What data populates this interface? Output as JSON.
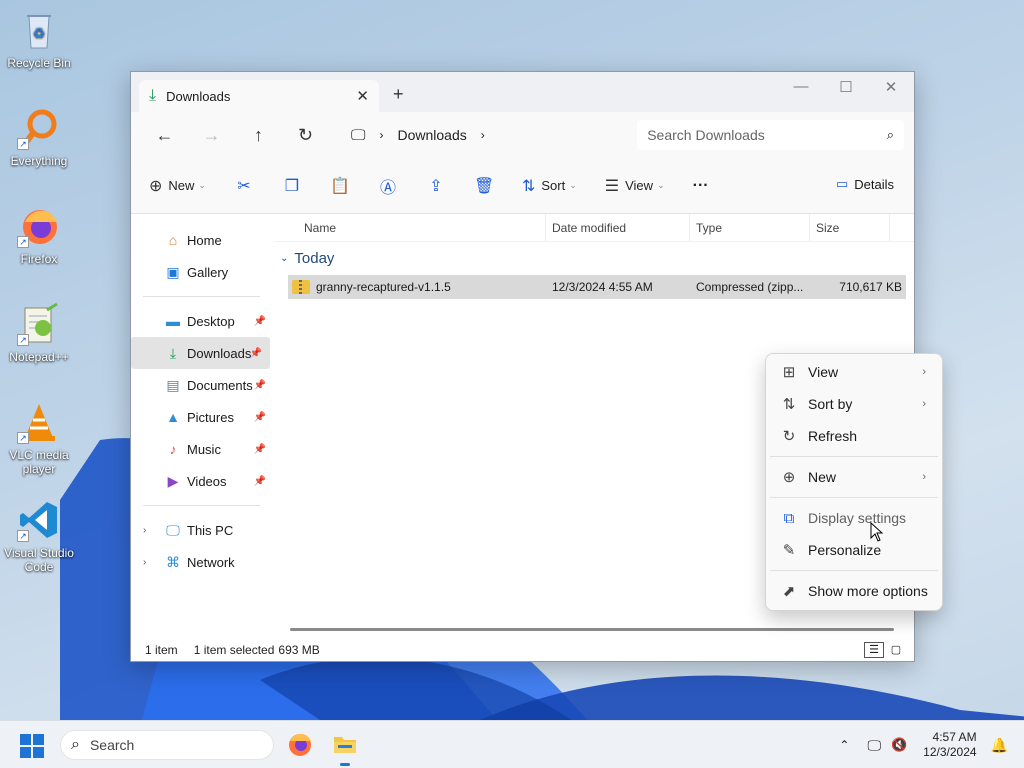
{
  "desktop": {
    "icons": [
      {
        "label": "Recycle Bin",
        "icon": "recycle-bin-icon"
      },
      {
        "label": "Everything",
        "icon": "everything-search-icon"
      },
      {
        "label": "Firefox",
        "icon": "firefox-icon"
      },
      {
        "label": "Notepad++",
        "icon": "notepad-plus-plus-icon"
      },
      {
        "label": "VLC media player",
        "icon": "vlc-icon"
      },
      {
        "label": "Visual Studio Code",
        "icon": "vscode-icon"
      }
    ]
  },
  "explorer": {
    "tab_title": "Downloads",
    "address_segment": "Downloads",
    "search_placeholder": "Search Downloads",
    "toolbar": {
      "new_label": "New",
      "sort_label": "Sort",
      "view_label": "View",
      "more_label": "···",
      "details_label": "Details"
    },
    "sidebar": {
      "home": "Home",
      "gallery": "Gallery",
      "pinned": [
        "Desktop",
        "Downloads",
        "Documents",
        "Pictures",
        "Music",
        "Videos"
      ],
      "this_pc": "This PC",
      "network": "Network"
    },
    "columns": {
      "name": "Name",
      "date": "Date modified",
      "type": "Type",
      "size": "Size"
    },
    "group_label": "Today",
    "files": [
      {
        "name": "granny-recaptured-v1.1.5",
        "date": "12/3/2024 4:55 AM",
        "type": "Compressed (zipp...",
        "size": "710,617 KB"
      }
    ],
    "status": {
      "count": "1 item",
      "selected": "1 item selected",
      "size": "693 MB"
    }
  },
  "context_menu": {
    "view": "View",
    "sort_by": "Sort by",
    "refresh": "Refresh",
    "new": "New",
    "display_settings": "Display settings",
    "personalize": "Personalize",
    "show_more": "Show more options"
  },
  "taskbar": {
    "search_label": "Search",
    "time": "4:57 AM",
    "date": "12/3/2024"
  }
}
